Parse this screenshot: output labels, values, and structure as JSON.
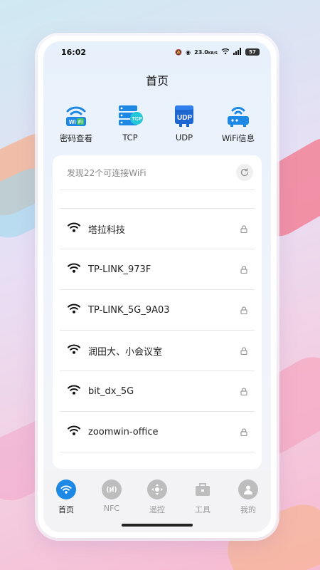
{
  "status": {
    "time": "16:02",
    "speed": "23.0",
    "speed_unit": "KB/S",
    "battery": "57"
  },
  "header": {
    "title": "首页"
  },
  "features": [
    {
      "label": "密码查看",
      "icon": "wifi-password-icon"
    },
    {
      "label": "TCP",
      "icon": "tcp-server-icon"
    },
    {
      "label": "UDP",
      "icon": "udp-icon"
    },
    {
      "label": "WiFi信息",
      "icon": "router-icon"
    }
  ],
  "wifi_card": {
    "summary": "发现22个可连接WiFi",
    "networks": [
      {
        "name": "塔拉科技"
      },
      {
        "name": "TP-LINK_973F"
      },
      {
        "name": "TP-LINK_5G_9A03"
      },
      {
        "name": "润田大、小会议室"
      },
      {
        "name": "bit_dx_5G"
      },
      {
        "name": "zoomwin-office"
      }
    ]
  },
  "tabbar": [
    {
      "label": "首页",
      "icon": "wifi-icon",
      "active": true
    },
    {
      "label": "NFC",
      "icon": "nfc-icon"
    },
    {
      "label": "遥控",
      "icon": "remote-control-icon"
    },
    {
      "label": "工具",
      "icon": "toolbox-icon"
    },
    {
      "label": "我的",
      "icon": "user-icon"
    }
  ],
  "colors": {
    "accent": "#1e88e5",
    "tab_inactive": "#bdbdbd"
  }
}
